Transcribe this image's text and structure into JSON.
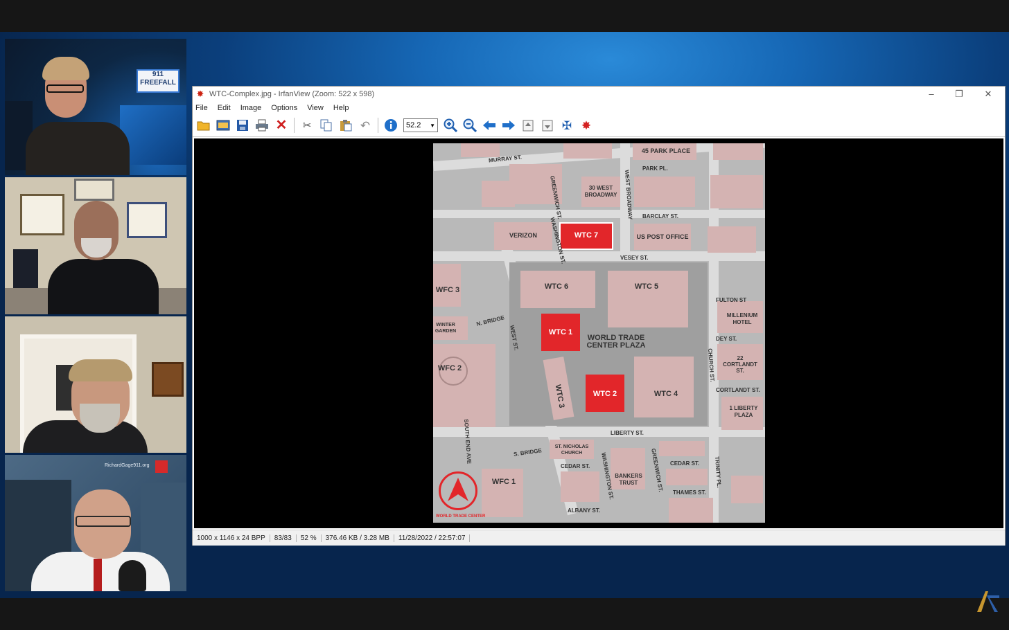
{
  "participants": {
    "tile1_sign": "911\nFREEFALL",
    "tile4_watermark": "RichardGage911.org"
  },
  "window": {
    "title": "WTC-Complex.jpg - IrfanView (Zoom: 522 x 598)",
    "minimize_glyph": "–",
    "maximize_glyph": "❐",
    "close_glyph": "✕"
  },
  "menu": [
    "File",
    "Edit",
    "Image",
    "Options",
    "View",
    "Help"
  ],
  "toolbar": {
    "zoom_value": "52.2"
  },
  "map": {
    "buildings": {
      "wtc7": "WTC 7",
      "wtc6": "WTC 6",
      "wtc5": "WTC 5",
      "wtc1": "WTC 1",
      "wtc2": "WTC 2",
      "wtc3": "WTC 3",
      "wtc4": "WTC 4",
      "plaza": "WORLD TRADE\nCENTER PLAZA",
      "verizon": "VERIZON",
      "post_office": "US POST OFFICE",
      "park_place": "45 PARK PLACE",
      "west_broadway30": "30 WEST\nBROADWAY",
      "wfc3": "WFC 3",
      "wfc2": "WFC 2",
      "wfc1": "WFC 1",
      "winter_garden": "WINTER\nGARDEN",
      "millenium": "MILLENIUM\nHOTEL",
      "cortlandt22": "22\nCORTLANDT\nST.",
      "liberty_plaza": "1 LIBERTY\nPLAZA",
      "bankers_trust": "BANKERS\nTRUST",
      "st_nicholas": "ST. NICHOLAS\nCHURCH"
    },
    "streets": {
      "murray": "MURRAY ST.",
      "park_pl": "PARK PL.",
      "barclay": "BARCLAY ST.",
      "vesey": "VESEY ST.",
      "fulton": "FULTON ST",
      "dey": "DEY ST.",
      "cortlandt": "CORTLANDT ST.",
      "liberty": "LIBERTY ST.",
      "cedar1": "CEDAR ST.",
      "cedar2": "CEDAR ST.",
      "thames": "THAMES ST.",
      "albany": "ALBANY ST.",
      "greenwich1": "GREENWICH ST.",
      "greenwich2": "GREENWICH ST.",
      "west_broadway": "WEST BROADWAY",
      "washington1": "WASHINGTON ST.",
      "washington2": "WASHINGTON ST.",
      "west": "WEST ST.",
      "church": "CHURCH ST.",
      "trinity": "TRINITY PL.",
      "south_end": "SOUTH END AVE",
      "n_bridge": "N. BRIDGE",
      "s_bridge": "S. BRIDGE"
    },
    "compass_label": "WORLD TRADE CENTER"
  },
  "status": {
    "dimensions": "1000 x 1146 x 24 BPP",
    "index": "83/83",
    "zoom": "52 %",
    "size": "376.46 KB / 3.28 MB",
    "datetime": "11/28/2022 / 22:57:07"
  },
  "colors": {
    "accent_red": "#e2262a",
    "building": "#d4b3b2",
    "road": "#dcdcdc",
    "block": "#9d9d9d"
  },
  "icons": [
    "open-icon",
    "thumbnails-icon",
    "save-icon",
    "print-icon",
    "delete-icon",
    "cut-icon",
    "copy-icon",
    "paste-icon",
    "undo-icon",
    "info-icon",
    "zoom-in-icon",
    "zoom-out-icon",
    "previous-icon",
    "next-icon",
    "first-page-icon",
    "last-page-icon",
    "settings-icon",
    "exit-icon"
  ]
}
